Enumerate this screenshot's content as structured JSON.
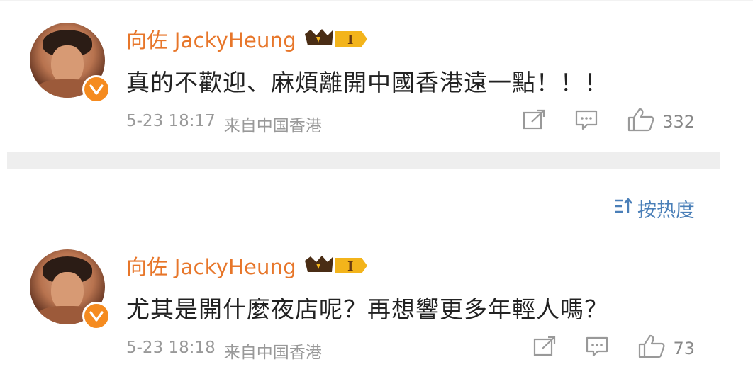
{
  "posts": [
    {
      "username": "向佐 JackyHeung",
      "badge_level": "I",
      "content": "真的不歡迎、麻煩離開中國香港遠一點！！！",
      "date": "5-23 18:17",
      "source": "来自中国香港",
      "like_count": "332"
    },
    {
      "username": "向佐 JackyHeung",
      "badge_level": "I",
      "content": "尤其是開什麼夜店呢？再想響更多年輕人嗎？",
      "date": "5-23 18:18",
      "source": "来自中国香港",
      "like_count": "73"
    }
  ],
  "sort": {
    "label": "按热度"
  },
  "colors": {
    "username": "#e7762a",
    "verified": "#f58b1f",
    "link": "#4a7fb8",
    "meta": "#999999"
  },
  "icons": [
    "avatar",
    "verified-icon",
    "crown-badge-icon",
    "share-icon",
    "comment-icon",
    "like-icon",
    "sort-icon"
  ]
}
